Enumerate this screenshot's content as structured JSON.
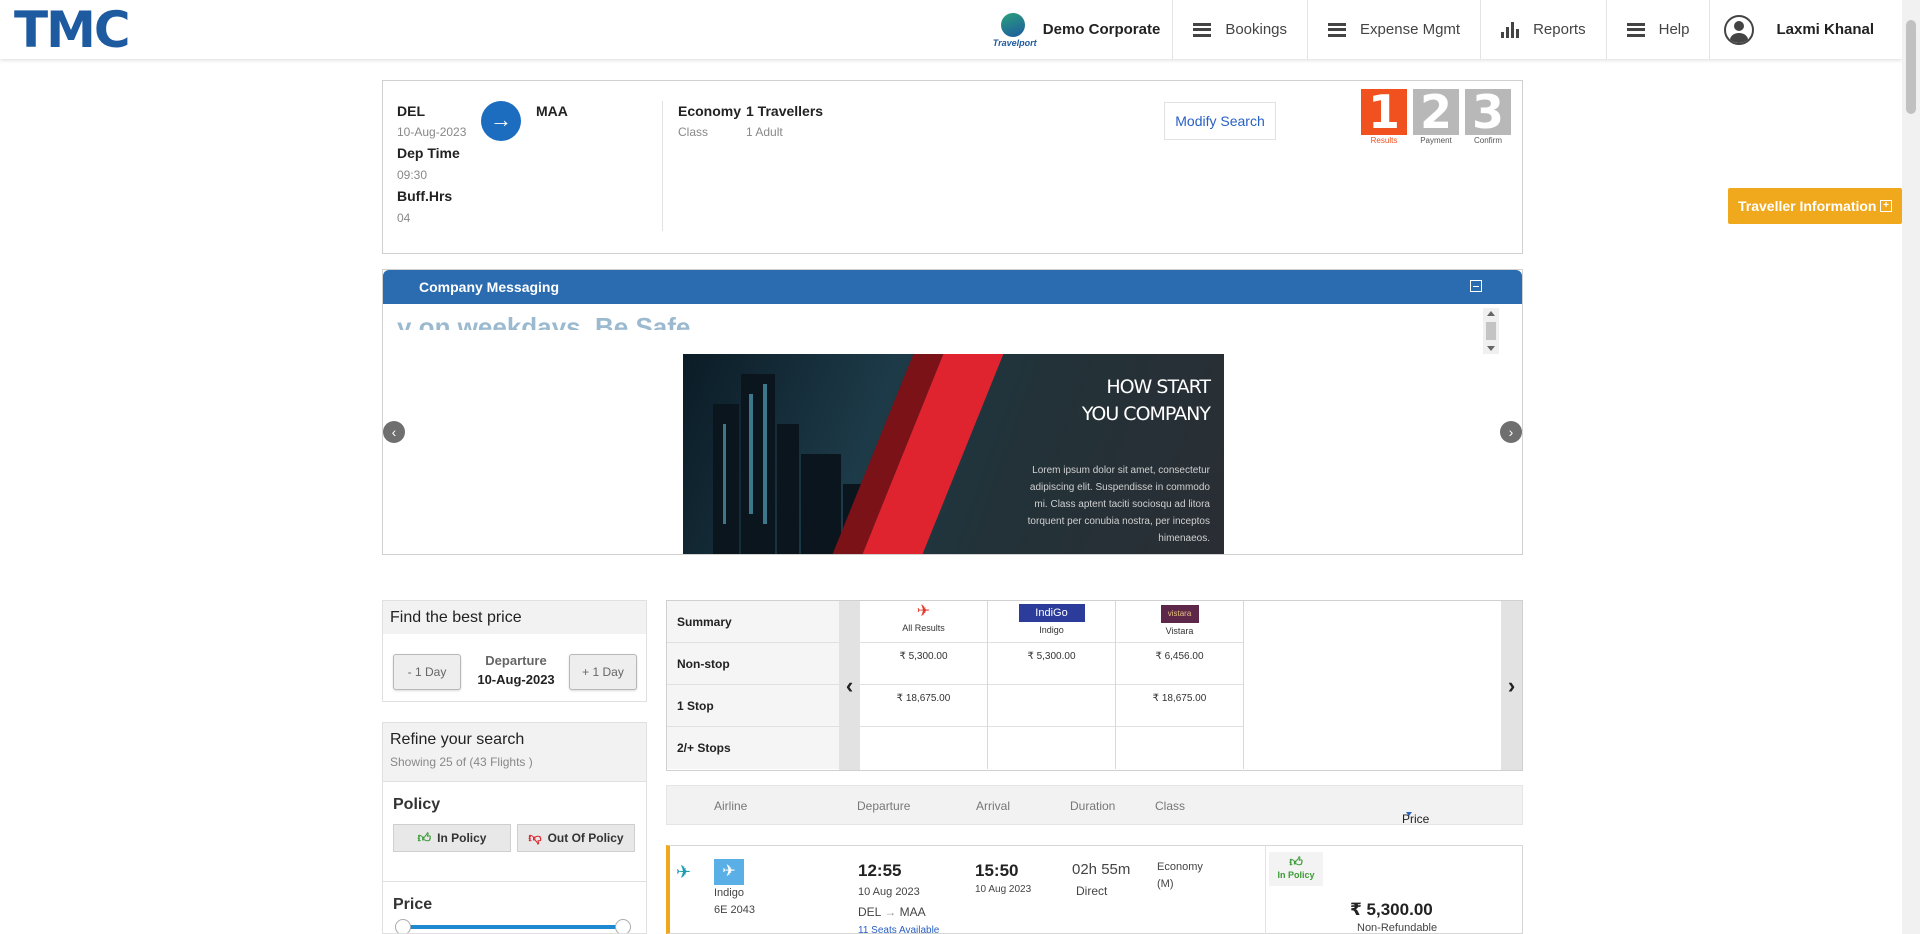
{
  "header": {
    "logo": "TMC",
    "brand_small": "Travelport",
    "company": "Demo Corporate",
    "nav": [
      "Bookings",
      "Expense Mgmt",
      "Reports",
      "Help"
    ],
    "user": "Laxmi Khanal"
  },
  "search": {
    "from": "DEL",
    "date": "10-Aug-2023",
    "dep_time_label": "Dep Time",
    "dep_time": "09:30",
    "buff_label": "Buff.Hrs",
    "buff": "04",
    "to": "MAA",
    "class_value": "Economy",
    "class_label": "Class",
    "travellers": "1 Travellers",
    "pax": "1 Adult",
    "modify": "Modify Search",
    "steps": [
      {
        "num": "1",
        "label": "Results"
      },
      {
        "num": "2",
        "label": "Payment"
      },
      {
        "num": "3",
        "label": "Confirm"
      }
    ]
  },
  "traveller_info": "Traveller Information",
  "company_messaging": {
    "title": "Company Messaging",
    "marquee": "y on weekdays. Be Safe",
    "banner_title_1": "HOW START",
    "banner_title_2": "YOU COMPANY",
    "banner_body": "Lorem ipsum dolor sit amet, consectetur adipiscing elit. Suspendisse in commodo mi. Class aptent taciti sociosqu ad litora torquent per conubia nostra, per inceptos himenaeos."
  },
  "best_price": {
    "title": "Find the best price",
    "minus": "- 1 Day",
    "plus": "+ 1 Day",
    "dep_label": "Departure",
    "dep_date": "10-Aug-2023"
  },
  "refine": {
    "title": "Refine your search",
    "showing": "Showing 25 of (43 Flights )",
    "policy_title": "Policy",
    "in_policy": "In Policy",
    "out_policy": "Out Of Policy",
    "price_title": "Price"
  },
  "matrix": {
    "row_labels": [
      "Summary",
      "Non-stop",
      "1 Stop",
      "2/+ Stops"
    ],
    "columns": [
      {
        "logo": "✈",
        "name": "All Results",
        "values": [
          "₹ 5,300.00",
          "₹ 18,675.00",
          ""
        ]
      },
      {
        "logo": "IndiGo",
        "name": "Indigo",
        "values": [
          "₹ 5,300.00",
          "",
          ""
        ]
      },
      {
        "logo": "vistara",
        "name": "Vistara",
        "values": [
          "₹ 6,456.00",
          "₹ 18,675.00",
          ""
        ]
      }
    ]
  },
  "results_header": {
    "airline": "Airline",
    "departure": "Departure",
    "arrival": "Arrival",
    "duration": "Duration",
    "class": "Class",
    "price": "Price"
  },
  "flight": {
    "airline": "Indigo",
    "flight_no": "6E  2043",
    "dep_time": "12:55",
    "dep_date": "10 Aug 2023",
    "route_from": "DEL",
    "route_to": "MAA",
    "seats": "11 Seats Available",
    "arr_time": "15:50",
    "arr_date": "10 Aug 2023",
    "duration": "02h 55m",
    "stops": "Direct",
    "class": "Economy",
    "class_code": "(M)",
    "policy": "In Policy",
    "price": "₹ 5,300.00",
    "refund": "Non-Refundable"
  }
}
